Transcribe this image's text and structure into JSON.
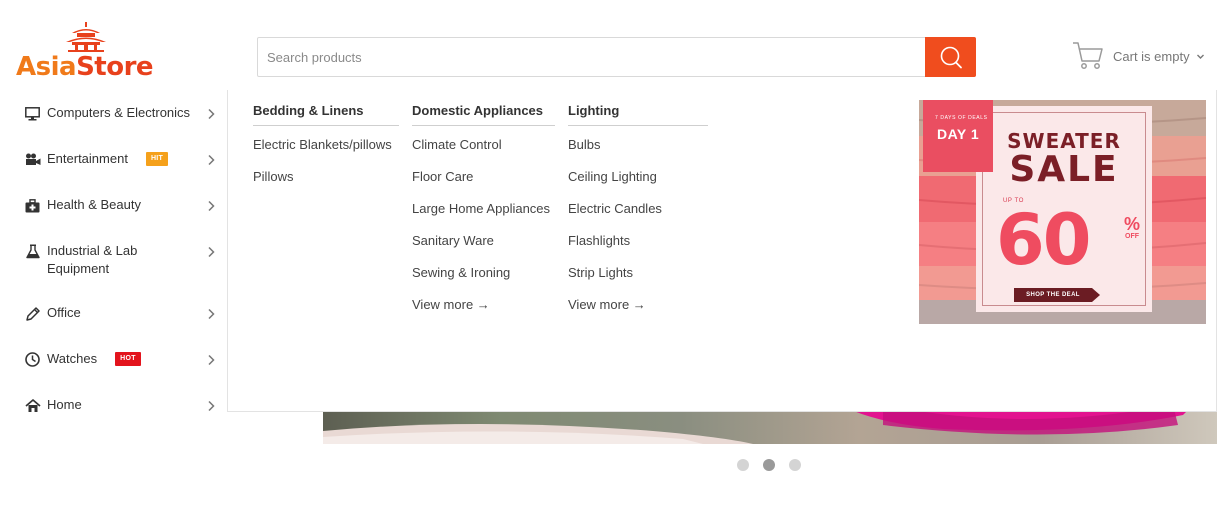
{
  "header": {
    "logo_part1": "Asia",
    "logo_part2": "Store",
    "search_placeholder": "Search products",
    "cart_text": "Cart is empty",
    "icons": {
      "search": "search-icon",
      "cart": "cart-icon",
      "chevron": "chevron-down-icon"
    }
  },
  "sidebar": {
    "items": [
      {
        "label": "Computers & Electronics",
        "icon": "monitor-icon",
        "badge": ""
      },
      {
        "label": "Entertainment",
        "icon": "video-camera-icon",
        "badge": "HIT"
      },
      {
        "label": "Health & Beauty",
        "icon": "medkit-icon",
        "badge": ""
      },
      {
        "label": "Industrial & Lab Equipment",
        "icon": "flask-icon",
        "badge": ""
      },
      {
        "label": "Office",
        "icon": "pencil-icon",
        "badge": ""
      },
      {
        "label": "Watches",
        "icon": "clock-icon",
        "badge": "HOT"
      },
      {
        "label": "Home",
        "icon": "home-icon",
        "badge": ""
      }
    ]
  },
  "mega_menu": {
    "columns": [
      {
        "heading": "Bedding & Linens",
        "links": [
          "Electric Blankets/pillows",
          "Pillows"
        ]
      },
      {
        "heading": "Domestic Appliances",
        "links": [
          "Climate Control",
          "Floor Care",
          "Large Home Appliances",
          "Sanitary Ware",
          "Sewing & Ironing",
          "View more →"
        ]
      },
      {
        "heading": "Lighting",
        "links": [
          "Bulbs",
          "Ceiling Lighting",
          "Electric Candles",
          "Flashlights",
          "Strip Lights",
          "View more →"
        ]
      }
    ],
    "promo": {
      "ribbon_small": "7 DAYS OF DEALS",
      "ribbon_day": "DAY 1",
      "title_line1": "SWEATER",
      "title_line2": "SALE",
      "upto": "UP TO",
      "percent": "60",
      "percent_sign": "%",
      "off": "OFF",
      "button": "SHOP THE DEAL"
    }
  },
  "slider": {
    "dots": 3,
    "active_index": 1
  },
  "colors": {
    "brand_orange": "#f07a1a",
    "brand_red": "#e8411c",
    "search_button": "#f04d1e",
    "badge_hit": "#f5a11b",
    "badge_hot": "#e3141d"
  }
}
